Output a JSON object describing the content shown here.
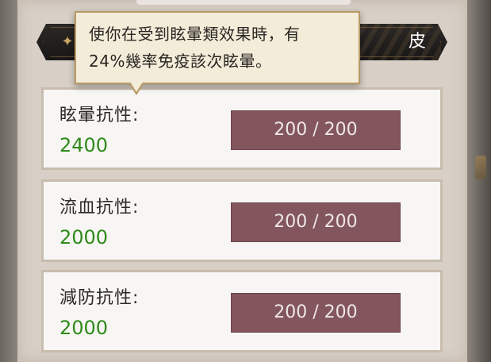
{
  "tab": {
    "label": "皮"
  },
  "tooltip": {
    "line1": "使你在受到眩暈類效果時，有",
    "line2": "24%幾率免疫該次眩暈。"
  },
  "resistances": [
    {
      "label": "眩暈抗性:",
      "value": "2400",
      "bar": "200 / 200"
    },
    {
      "label": "流血抗性:",
      "value": "2000",
      "bar": "200 / 200"
    },
    {
      "label": "減防抗性:",
      "value": "2000",
      "bar": "200 / 200"
    }
  ],
  "colors": {
    "value_green": "#2f8a1a",
    "bar_fill": "#83565e",
    "tooltip_bg": "#f3ecd9"
  },
  "icons": {
    "tab_ornament": "ornament-icon"
  }
}
